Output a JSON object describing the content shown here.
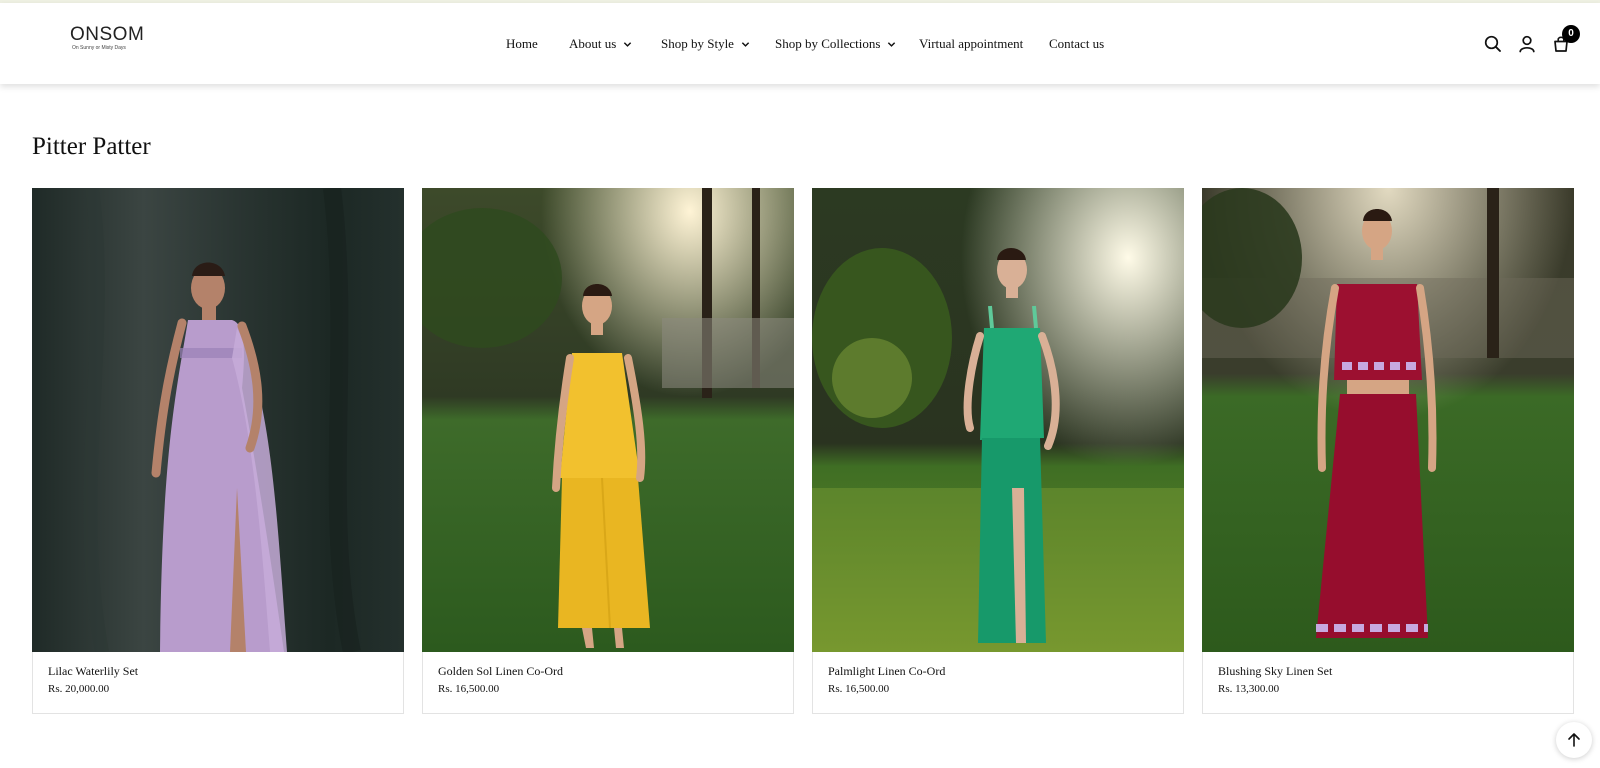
{
  "brand": {
    "name": "ONSOM",
    "tagline": "On Sunny or Misty Days"
  },
  "nav": {
    "items": [
      {
        "label": "Home",
        "has_dropdown": false
      },
      {
        "label": "About us",
        "has_dropdown": true
      },
      {
        "label": "Shop by Style",
        "has_dropdown": true
      },
      {
        "label": "Shop by Collections",
        "has_dropdown": true
      },
      {
        "label": "Virtual appointment",
        "has_dropdown": false
      },
      {
        "label": "Contact us",
        "has_dropdown": false
      }
    ]
  },
  "header_icons": {
    "search": "search-icon",
    "account": "user-icon",
    "cart": "shopping-bag-icon",
    "cart_count": "0"
  },
  "collection": {
    "title": "Pitter Patter"
  },
  "products": [
    {
      "name": "Lilac Waterlily Set",
      "price": "Rs. 20,000.00",
      "garment_color": "#b89ccc",
      "backdrop": "dark-drape"
    },
    {
      "name": "Golden Sol Linen Co-Ord",
      "price": "Rs. 16,500.00",
      "garment_color": "#f2c12e",
      "backdrop": "sunlit-garden"
    },
    {
      "name": "Palmlight Linen Co-Ord",
      "price": "Rs. 16,500.00",
      "garment_color": "#1fa874",
      "backdrop": "sunlit-garden"
    },
    {
      "name": "Blushing Sky Linen Set",
      "price": "Rs. 13,300.00",
      "garment_color": "#9c1030",
      "backdrop": "sunlit-garden"
    }
  ],
  "colors": {
    "header_bg": "#ffffff",
    "text": "#111111",
    "card_border": "#e3e3e3",
    "cart_badge": "#000000"
  },
  "back_to_top": "arrow-up-icon"
}
